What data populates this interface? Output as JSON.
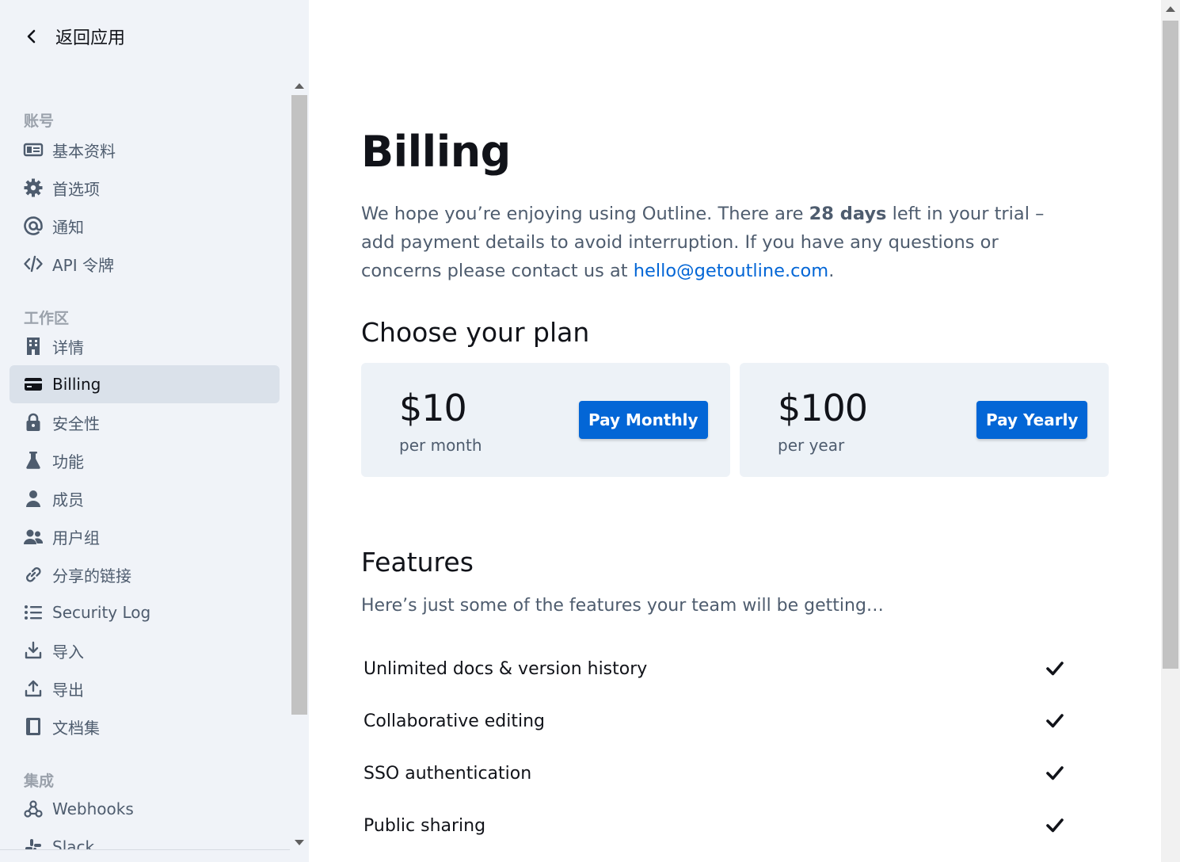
{
  "sidebar": {
    "back_label": "返回应用",
    "sections": {
      "account": "账号",
      "workspace": "工作区",
      "integrations": "集成"
    },
    "items": [
      {
        "label": "基本资料",
        "icon": "profile-icon"
      },
      {
        "label": "首选项",
        "icon": "gear-icon"
      },
      {
        "label": "通知",
        "icon": "at-icon"
      },
      {
        "label": "API 令牌",
        "icon": "code-icon"
      },
      {
        "label": "详情",
        "icon": "building-icon"
      },
      {
        "label": "Billing",
        "icon": "credit-card-icon",
        "active": true
      },
      {
        "label": "安全性",
        "icon": "padlock-icon"
      },
      {
        "label": "功能",
        "icon": "beaker-icon"
      },
      {
        "label": "成员",
        "icon": "user-icon"
      },
      {
        "label": "用户组",
        "icon": "group-icon"
      },
      {
        "label": "分享的链接",
        "icon": "link-icon"
      },
      {
        "label": "Security Log",
        "icon": "list-icon"
      },
      {
        "label": "导入",
        "icon": "download-icon"
      },
      {
        "label": "导出",
        "icon": "upload-icon"
      },
      {
        "label": "文档集",
        "icon": "collection-icon"
      },
      {
        "label": "Webhooks",
        "icon": "webhook-icon"
      },
      {
        "label": "Slack",
        "icon": "slack-icon"
      }
    ]
  },
  "main": {
    "title": "Billing",
    "intro": {
      "before": "We hope you’re enjoying using Outline. There are ",
      "days": "28 days",
      "middle": " left in your trial – add payment details to avoid interruption. If you have any questions or concerns please contact us at ",
      "email": "hello@getoutline.com",
      "after": "."
    },
    "plan_heading": "Choose your plan",
    "plans": [
      {
        "price": "$10",
        "period": "per month",
        "button": "Pay Monthly"
      },
      {
        "price": "$100",
        "period": "per year",
        "button": "Pay Yearly"
      }
    ],
    "features_heading": "Features",
    "features_sub": "Here’s just some of the features your team will be getting…",
    "features": [
      "Unlimited docs & version history",
      "Collaborative editing",
      "SSO authentication",
      "Public sharing"
    ]
  },
  "colors": {
    "accent": "#0366d6",
    "sidebar_bg": "#f0f3f8",
    "active_item_bg": "#dae1ea",
    "card_bg": "#edf2f7"
  }
}
